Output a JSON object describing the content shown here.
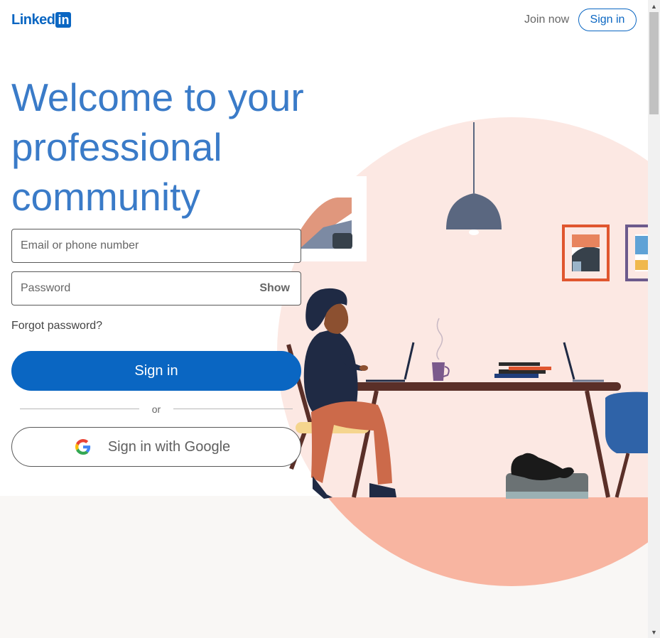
{
  "header": {
    "logo_text": "Linked",
    "logo_box": "in",
    "join_now": "Join now",
    "sign_in": "Sign in"
  },
  "hero": {
    "headline_lines": [
      "Welcome to your",
      "professional",
      "community"
    ]
  },
  "form": {
    "email_placeholder": "Email or phone number",
    "password_placeholder": "Password",
    "show_label": "Show",
    "forgot_password": "Forgot password?",
    "sign_in": "Sign in",
    "divider_text": "or",
    "google_sign_in": "Sign in with Google"
  },
  "scrollbar": {
    "up_icon": "scroll-up-arrow-icon",
    "down_icon": "scroll-down-arrow-icon"
  },
  "colors": {
    "brand_blue": "#0a66c2",
    "headline_blue": "#3a7bc8",
    "illustration_pink": "#fce8e3",
    "floor_salmon": "#f8b5a1"
  }
}
